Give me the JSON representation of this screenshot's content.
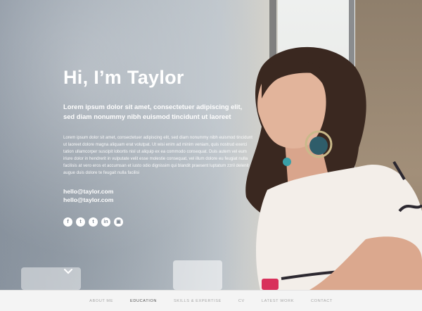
{
  "hero": {
    "title": "Hi, I’m Taylor",
    "lead": "Lorem ipsum dolor sit amet, consectetuer adipiscing elit, sed diam nonummy nibh euismod tincidunt ut laoreet",
    "body": "Lorem ipsum dolor sit amet, consectetuer adipiscing elit, sed diam nonummy nibh euismod tincidunt ut laoreet dolore magna aliquam erat volutpat. Ut wisi enim ad minim veniam, quis nostrud exerci tation ullamcorper suscipit lobortis nisl ut aliquip ex ea commodo consequat. Duis autem vel eum iriure dolor in hendrerit in vulputate velit esse molestie consequat, vel illum dolore eu feugiat nulla facilisis at vero eros et accumsan et iusto odio dignissim qui blandit praesent luptatum zzril delenit augue duis dolore te feugait nulla facilisi",
    "emails": [
      "hello@taylor.com",
      "hello@taylor.com"
    ],
    "socials": [
      {
        "icon": "facebook-icon",
        "glyph": "f"
      },
      {
        "icon": "twitter-icon",
        "glyph": "t"
      },
      {
        "icon": "tumblr-icon",
        "glyph": "t"
      },
      {
        "icon": "linkedin-icon",
        "glyph": "in"
      },
      {
        "icon": "instagram-icon",
        "glyph": "▣"
      }
    ],
    "scroll_icon": "chevron-down-icon"
  },
  "nav": {
    "items": [
      "About me",
      "Education",
      "Skills & Expertise",
      "CV",
      "Latest work",
      "Contact"
    ],
    "active": "Education"
  }
}
